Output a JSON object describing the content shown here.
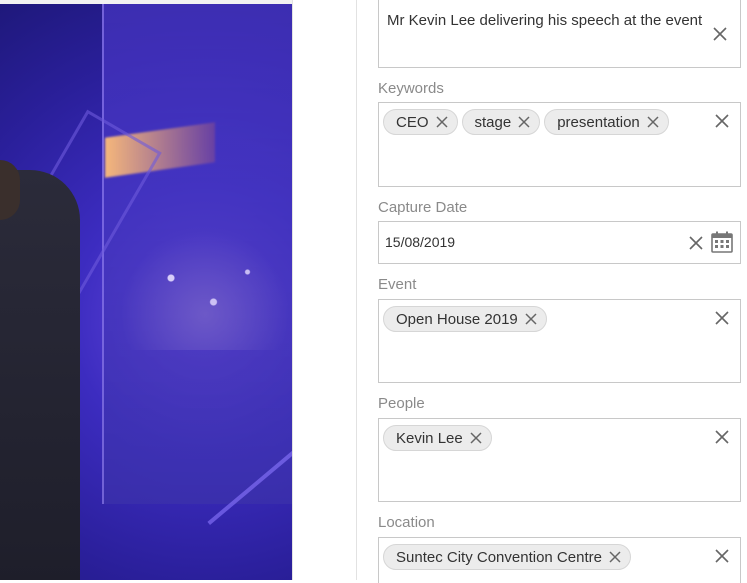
{
  "description_field": {
    "value": "Mr Kevin Lee delivering his speech at the event"
  },
  "keywords": {
    "label": "Keywords",
    "chips": [
      "CEO",
      "stage",
      "presentation"
    ]
  },
  "capture_date": {
    "label": "Capture Date",
    "value": "15/08/2019"
  },
  "event": {
    "label": "Event",
    "chips": [
      "Open House 2019"
    ]
  },
  "people": {
    "label": "People",
    "chips": [
      "Kevin Lee"
    ]
  },
  "location": {
    "label": "Location",
    "chips": [
      "Suntec City Convention Centre"
    ]
  },
  "icons": {
    "clear": "close-icon",
    "chip_remove": "close-icon",
    "calendar": "calendar-icon"
  }
}
